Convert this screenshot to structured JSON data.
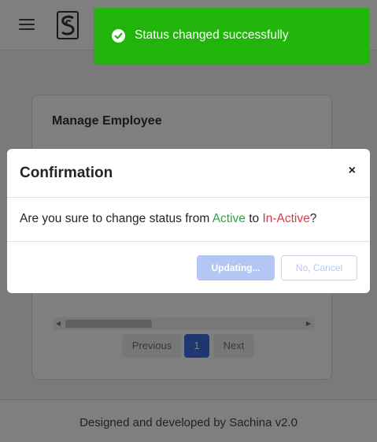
{
  "header": {
    "menu_icon": "hamburger-icon",
    "logo_icon": "app-logo-icon"
  },
  "card": {
    "title": "Manage Employee",
    "pagination": {
      "previous": "Previous",
      "current_page": "1",
      "next": "Next"
    }
  },
  "footer": {
    "text": "Designed and developed by Sachina v2.0"
  },
  "modal": {
    "title": "Confirmation",
    "close_label": "×",
    "body_prefix": "Are you sure to change status from ",
    "from_status": "Active",
    "body_middle": " to ",
    "to_status": "In-Active",
    "body_suffix": "?",
    "confirm_label": "Updating...",
    "cancel_label": "No, Cancel"
  },
  "toast": {
    "message": "Status changed successfully",
    "icon": "check-circle-icon"
  },
  "colors": {
    "toast_bg": "#21b40a",
    "active_status": "#28a745",
    "inactive_status": "#dc3545",
    "primary": "#3f6fe0"
  }
}
